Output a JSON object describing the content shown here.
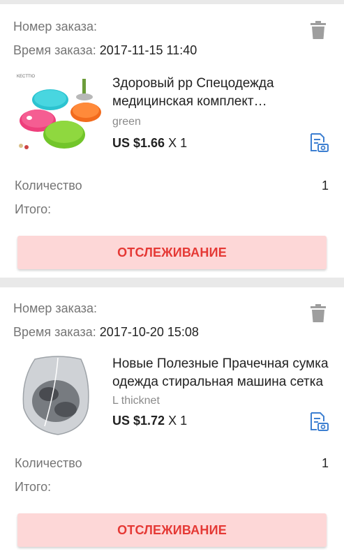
{
  "orders": [
    {
      "order_number_label": "Номер заказа:",
      "order_time_label": "Время заказа:",
      "order_time": "2017-11-15 11:40",
      "product_title": "Здоровый pp Спецодежда медицинская комплект Портативная коробка для таблеток",
      "variant": "green",
      "price": "US $1.66",
      "multiplier": " X 1",
      "quantity_label": "Количество",
      "quantity": "1",
      "total_label": "Итого:",
      "track_label": "ОТСЛЕЖИВАНИЕ",
      "thumb_brand": "KECTTIO"
    },
    {
      "order_number_label": "Номер заказа:",
      "order_time_label": "Время заказа:",
      "order_time": "2017-10-20 15:08",
      "product_title": "Новые Полезные Прачечная сумка одежда стиральная машина сетка",
      "variant": "L thicknet",
      "price": "US $1.72",
      "multiplier": " X 1",
      "quantity_label": "Количество",
      "quantity": "1",
      "total_label": "Итого:",
      "track_label": "ОТСЛЕЖИВАНИЕ"
    }
  ],
  "colors": {
    "track_text": "#e53935",
    "track_bg": "#fdd7d7",
    "icon_blue": "#3d7fd1",
    "trash_gray": "#9e9e9e"
  },
  "icons": [
    "trash-icon",
    "snapshot-icon"
  ]
}
